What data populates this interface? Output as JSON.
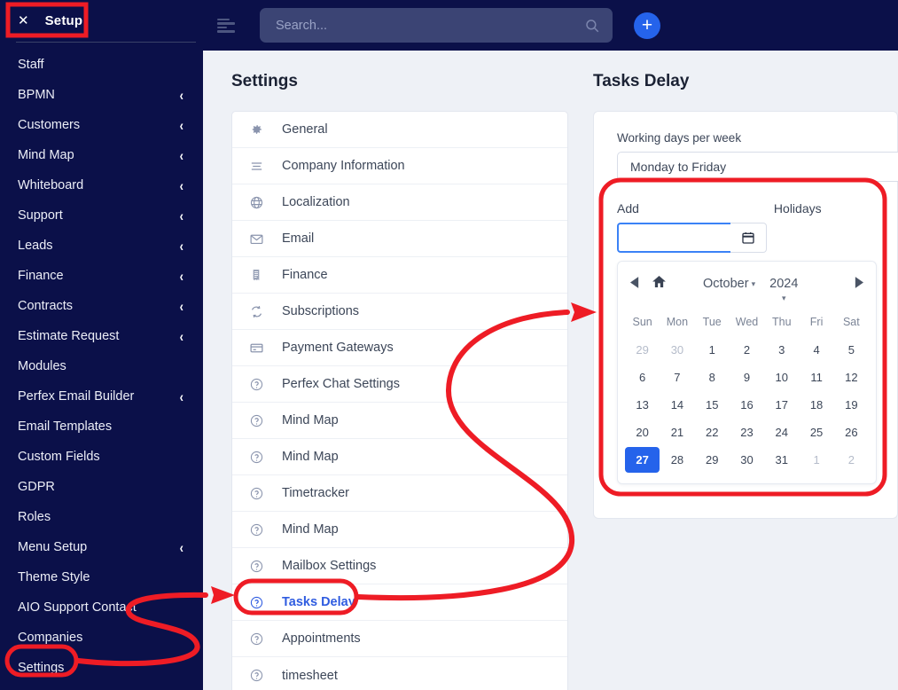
{
  "sidebar": {
    "setup": {
      "close_label": "✕",
      "title": "Setup"
    },
    "items": [
      {
        "label": "Staff",
        "caret": false
      },
      {
        "label": "BPMN",
        "caret": true
      },
      {
        "label": "Customers",
        "caret": true
      },
      {
        "label": "Mind Map",
        "caret": true
      },
      {
        "label": "Whiteboard",
        "caret": true
      },
      {
        "label": "Support",
        "caret": true
      },
      {
        "label": "Leads",
        "caret": true
      },
      {
        "label": "Finance",
        "caret": true
      },
      {
        "label": "Contracts",
        "caret": true
      },
      {
        "label": "Estimate Request",
        "caret": true
      },
      {
        "label": "Modules",
        "caret": false
      },
      {
        "label": "Perfex Email Builder",
        "caret": true
      },
      {
        "label": "Email Templates",
        "caret": false
      },
      {
        "label": "Custom Fields",
        "caret": false
      },
      {
        "label": "GDPR",
        "caret": false
      },
      {
        "label": "Roles",
        "caret": false
      },
      {
        "label": "Menu Setup",
        "caret": true
      },
      {
        "label": "Theme Style",
        "caret": false
      },
      {
        "label": "AIO Support Contact",
        "caret": false
      },
      {
        "label": "Companies",
        "caret": false
      },
      {
        "label": "Settings",
        "caret": false
      }
    ],
    "caret_glyph": "‹"
  },
  "topbar": {
    "menu_icon": "hamburger-icon",
    "search": {
      "value": "",
      "placeholder": "Search..."
    },
    "search_icon": "search-icon",
    "add_label": "+"
  },
  "settings_panel": {
    "title": "Settings",
    "rows": [
      {
        "label": "General",
        "icon": "gear-icon"
      },
      {
        "label": "Company Information",
        "icon": "list-icon"
      },
      {
        "label": "Localization",
        "icon": "globe-icon"
      },
      {
        "label": "Email",
        "icon": "envelope-icon"
      },
      {
        "label": "Finance",
        "icon": "receipt-icon"
      },
      {
        "label": "Subscriptions",
        "icon": "refresh-icon"
      },
      {
        "label": "Payment Gateways",
        "icon": "credit-card-icon"
      },
      {
        "label": "Perfex Chat Settings",
        "icon": "question-circle-icon"
      },
      {
        "label": "Mind Map",
        "icon": "question-circle-icon"
      },
      {
        "label": "Mind Map",
        "icon": "question-circle-icon"
      },
      {
        "label": "Timetracker",
        "icon": "question-circle-icon"
      },
      {
        "label": "Mind Map",
        "icon": "question-circle-icon"
      },
      {
        "label": "Mailbox Settings",
        "icon": "question-circle-icon"
      },
      {
        "label": "Tasks Delay",
        "icon": "question-circle-icon",
        "highlight": true
      },
      {
        "label": "Appointments",
        "icon": "question-circle-icon"
      },
      {
        "label": "timesheet",
        "icon": "question-circle-icon"
      }
    ]
  },
  "tasks_delay": {
    "title": "Tasks Delay",
    "working_days_label": "Working days per week",
    "working_days_value": "Monday to Friday",
    "add_label": "Add",
    "holidays_label": "Holidays",
    "date_input_value": "",
    "date_input_placeholder": "",
    "date_picker_icon": "calendar-icon",
    "calendar": {
      "prev_icon": "prev-arrow-icon",
      "home_icon": "home-icon",
      "next_icon": "next-arrow-icon",
      "month": "October",
      "year": "2024",
      "month_caret": "▾",
      "year_caret": "▾",
      "weekdays": [
        "Sun",
        "Mon",
        "Tue",
        "Wed",
        "Thu",
        "Fri",
        "Sat"
      ],
      "weeks": [
        [
          {
            "d": "29",
            "m": true
          },
          {
            "d": "30",
            "m": true
          },
          {
            "d": "1"
          },
          {
            "d": "2"
          },
          {
            "d": "3"
          },
          {
            "d": "4"
          },
          {
            "d": "5"
          }
        ],
        [
          {
            "d": "6"
          },
          {
            "d": "7"
          },
          {
            "d": "8"
          },
          {
            "d": "9"
          },
          {
            "d": "10"
          },
          {
            "d": "11"
          },
          {
            "d": "12"
          }
        ],
        [
          {
            "d": "13"
          },
          {
            "d": "14"
          },
          {
            "d": "15"
          },
          {
            "d": "16"
          },
          {
            "d": "17"
          },
          {
            "d": "18"
          },
          {
            "d": "19"
          }
        ],
        [
          {
            "d": "20"
          },
          {
            "d": "21"
          },
          {
            "d": "22"
          },
          {
            "d": "23"
          },
          {
            "d": "24"
          },
          {
            "d": "25"
          },
          {
            "d": "26"
          }
        ],
        [
          {
            "d": "27",
            "sel": true
          },
          {
            "d": "28"
          },
          {
            "d": "29"
          },
          {
            "d": "30"
          },
          {
            "d": "31"
          },
          {
            "d": "1",
            "m": true
          },
          {
            "d": "2",
            "m": true
          }
        ]
      ]
    }
  },
  "colors": {
    "sidebar_bg": "#0b1049",
    "accent_blue": "#2563eb",
    "annotation_red": "#ee1c25",
    "page_bg": "#eef1f6",
    "card_bg": "#ffffff"
  },
  "annotations": {
    "setup_box": "highlight-rect-setup",
    "settings_ellipse": "highlight-ellipse-settings",
    "tasks_delay_ellipse": "highlight-ellipse-tasks-delay",
    "holidays_box": "highlight-rect-holidays",
    "arrow_settings_to_tasks": "arrow-settings-to-tasks-delay",
    "arrow_tasks_to_panel": "arrow-tasks-delay-to-panel"
  }
}
